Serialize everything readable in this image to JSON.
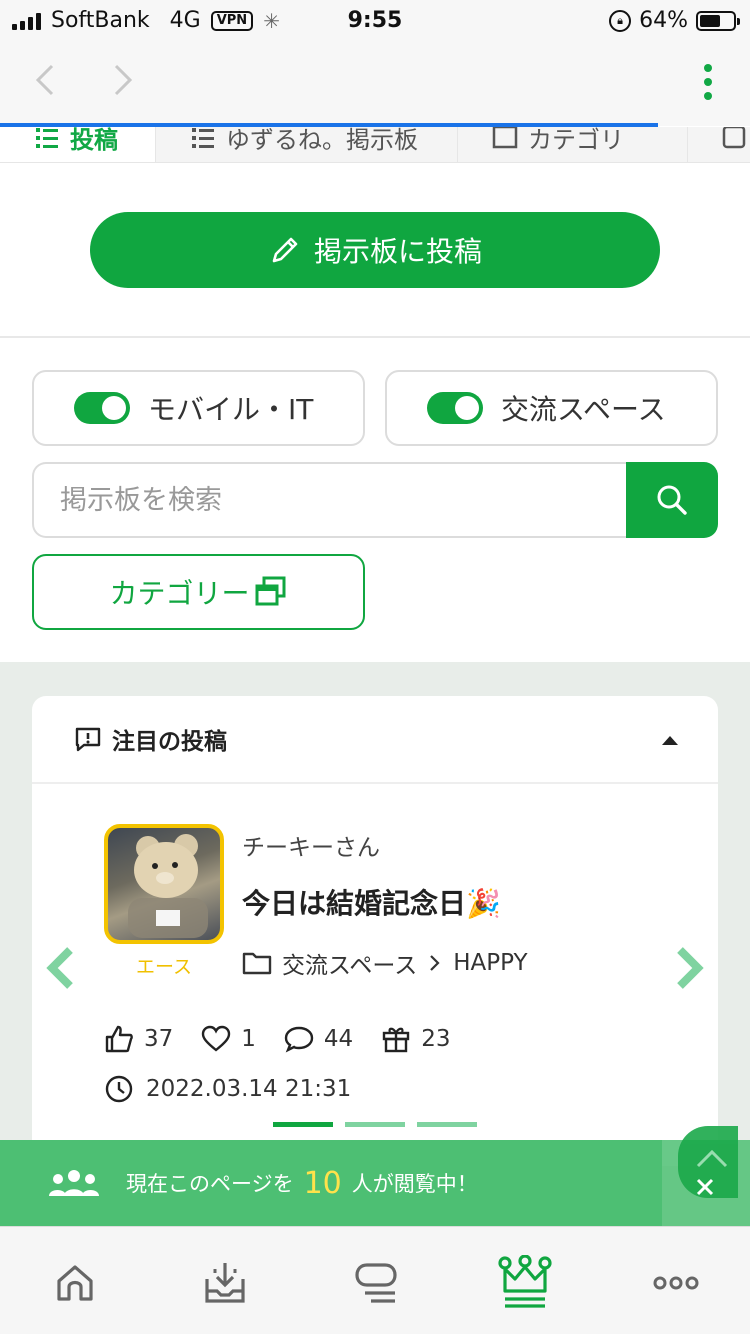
{
  "status_bar": {
    "carrier": "SoftBank",
    "network": "4G",
    "vpn": "VPN",
    "time": "9:55",
    "battery": "64%",
    "battery_level": 0.64
  },
  "tabs": [
    {
      "label": "投稿",
      "active": true
    },
    {
      "label": "ゆずるね。掲示板",
      "active": false
    },
    {
      "label": "カテゴリ",
      "active": false
    }
  ],
  "post_button": {
    "label": "掲示板に投稿",
    "icon": "pencil-icon"
  },
  "filters": [
    {
      "label": "モバイル・IT",
      "on": true
    },
    {
      "label": "交流スペース",
      "on": true
    }
  ],
  "search": {
    "placeholder": "掲示板を検索",
    "value": ""
  },
  "category_button": {
    "label": "カテゴリー"
  },
  "featured": {
    "heading": "注目の投稿",
    "post": {
      "user": "チーキーさん",
      "rank": "エース",
      "title": "今日は結婚記念日🎉",
      "category": "交流スペース",
      "subcategory": "HAPPY",
      "likes": "37",
      "favorites": "1",
      "comments": "44",
      "gifts": "23",
      "date": "2022.03.14 21:31"
    },
    "carousel_pages": 3,
    "carousel_active": 0
  },
  "viewers_banner": {
    "prefix": "現在このページを",
    "count": "10",
    "suffix": "人が閲覧中！"
  },
  "colors": {
    "brand_green": "#10a640",
    "rank_gold": "#f3c300"
  }
}
